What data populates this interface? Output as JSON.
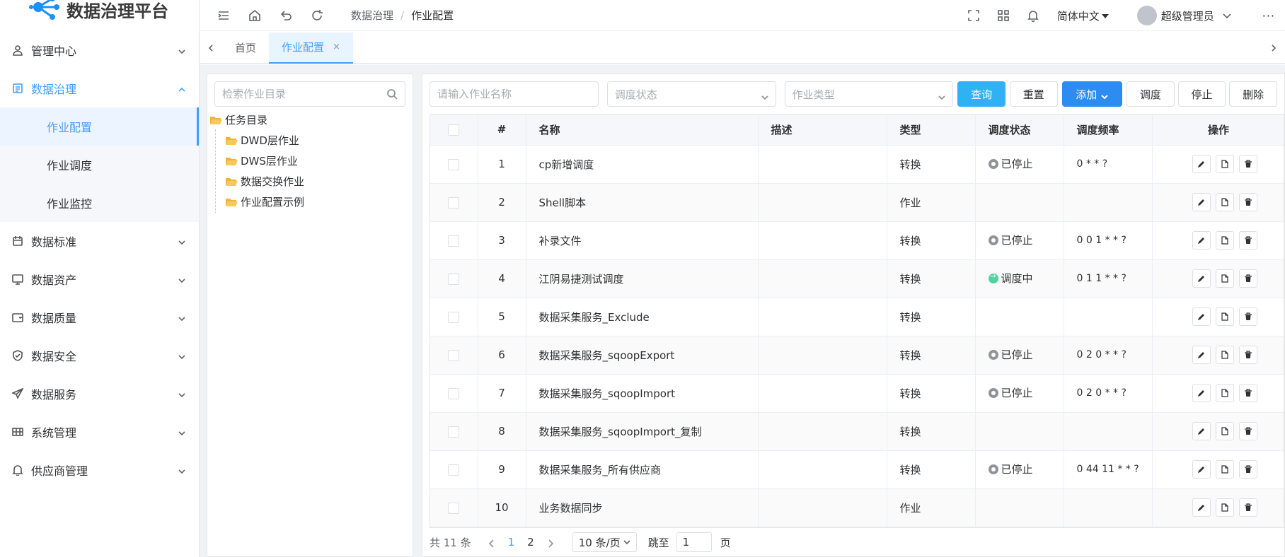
{
  "app": {
    "title": "数据治理平台"
  },
  "sidebar": {
    "items": [
      {
        "label": "管理中心",
        "icon": "user-icon"
      },
      {
        "label": "数据治理",
        "icon": "document-icon",
        "open": true,
        "children": [
          {
            "label": "作业配置",
            "active": true
          },
          {
            "label": "作业调度"
          },
          {
            "label": "作业监控"
          }
        ]
      },
      {
        "label": "数据标准",
        "icon": "calendar-icon"
      },
      {
        "label": "数据资产",
        "icon": "monitor-icon"
      },
      {
        "label": "数据质量",
        "icon": "wallet-icon"
      },
      {
        "label": "数据安全",
        "icon": "shield-icon"
      },
      {
        "label": "数据服务",
        "icon": "send-icon"
      },
      {
        "label": "系统管理",
        "icon": "grid-icon"
      },
      {
        "label": "供应商管理",
        "icon": "bell-icon"
      }
    ]
  },
  "header": {
    "breadcrumb": [
      "数据治理",
      "作业配置"
    ],
    "language": "简体中文",
    "username": "超级管理员",
    "more": "···"
  },
  "tabs": [
    {
      "label": "首页",
      "active": false
    },
    {
      "label": "作业配置",
      "active": true,
      "close": "×"
    }
  ],
  "tree": {
    "search_placeholder": "检索作业目录",
    "root": "任务目录",
    "children": [
      "DWD层作业",
      "DWS层作业",
      "数据交换作业",
      "作业配置示例"
    ]
  },
  "toolbar": {
    "name_placeholder": "请输入作业名称",
    "status_placeholder": "调度状态",
    "type_placeholder": "作业类型",
    "query": "查询",
    "reset": "重置",
    "add": "添加",
    "schedule": "调度",
    "stop": "停止",
    "delete": "删除"
  },
  "table": {
    "headers": [
      "#",
      "名称",
      "描述",
      "类型",
      "调度状态",
      "调度频率",
      "操作"
    ],
    "rows": [
      {
        "no": "1",
        "name": "cp新增调度",
        "desc": "",
        "type": "转换",
        "status": "已停止",
        "status_kind": "stop",
        "freq": "0 * * ?"
      },
      {
        "no": "2",
        "name": "Shell脚本",
        "desc": "",
        "type": "作业",
        "status": "",
        "status_kind": "",
        "freq": ""
      },
      {
        "no": "3",
        "name": "补录文件",
        "desc": "",
        "type": "转换",
        "status": "已停止",
        "status_kind": "stop",
        "freq": "0 0 1 * * ?"
      },
      {
        "no": "4",
        "name": "江阴易捷测试调度",
        "desc": "",
        "type": "转换",
        "status": "调度中",
        "status_kind": "run",
        "freq": "0 1 1 * * ?"
      },
      {
        "no": "5",
        "name": "数据采集服务_Exclude",
        "desc": "",
        "type": "转换",
        "status": "",
        "status_kind": "",
        "freq": ""
      },
      {
        "no": "6",
        "name": "数据采集服务_sqoopExport",
        "desc": "",
        "type": "转换",
        "status": "已停止",
        "status_kind": "stop",
        "freq": "0 2 0 * * ?"
      },
      {
        "no": "7",
        "name": "数据采集服务_sqoopImport",
        "desc": "",
        "type": "转换",
        "status": "已停止",
        "status_kind": "stop",
        "freq": "0 2 0 * * ?"
      },
      {
        "no": "8",
        "name": "数据采集服务_sqoopImport_复制",
        "desc": "",
        "type": "转换",
        "status": "",
        "status_kind": "",
        "freq": ""
      },
      {
        "no": "9",
        "name": "数据采集服务_所有供应商",
        "desc": "",
        "type": "转换",
        "status": "已停止",
        "status_kind": "stop",
        "freq": "0 44 11 * * ?"
      },
      {
        "no": "10",
        "name": "业务数据同步",
        "desc": "",
        "type": "作业",
        "status": "",
        "status_kind": "",
        "freq": ""
      }
    ]
  },
  "pager": {
    "total": "共 11 条",
    "pages": [
      "1",
      "2"
    ],
    "current": "1",
    "page_size": "10 条/页",
    "jump_label": "跳至",
    "jump_value": "1",
    "page_suffix": "页"
  },
  "colors": {
    "accent": "#409eff",
    "query": "#30b1f4",
    "add": "#2d8cf0",
    "stopped": "#909399",
    "running": "#4fd1a0"
  }
}
